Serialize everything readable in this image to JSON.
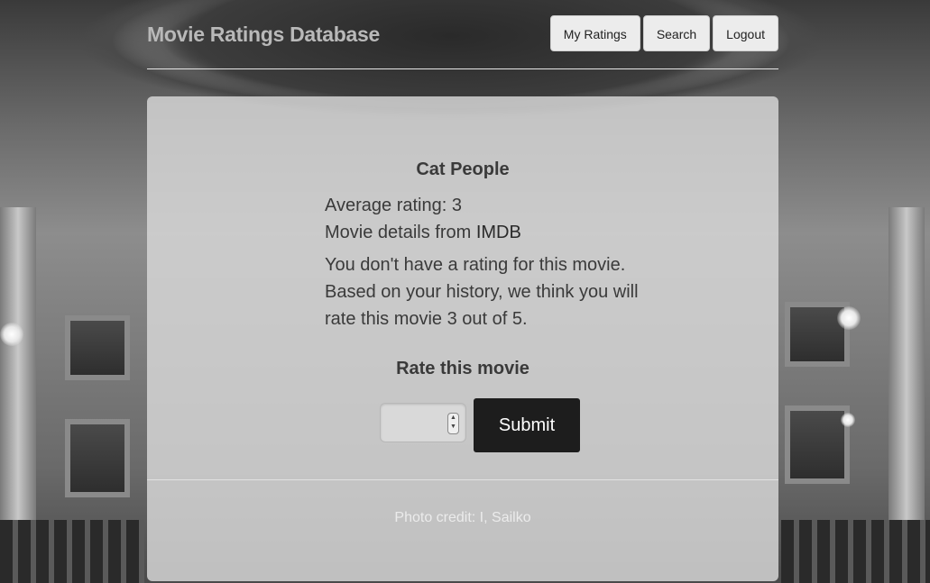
{
  "header": {
    "brand": "Movie Ratings Database",
    "nav": [
      {
        "label": "My Ratings"
      },
      {
        "label": "Search"
      },
      {
        "label": "Logout"
      }
    ]
  },
  "movie": {
    "title": "Cat People",
    "average_rating_text": "Average rating: 3",
    "details_prefix": "Movie details from ",
    "details_link": "IMDB",
    "prediction_text": "You don't have a rating for this movie. Based on your history, we think you will rate this movie 3 out of 5."
  },
  "rate": {
    "heading": "Rate this movie",
    "input_value": "",
    "submit_label": "Submit"
  },
  "footer": {
    "credit": "Photo credit: I, Sailko"
  },
  "icons": {
    "spinner": "number-spinner-icon"
  }
}
